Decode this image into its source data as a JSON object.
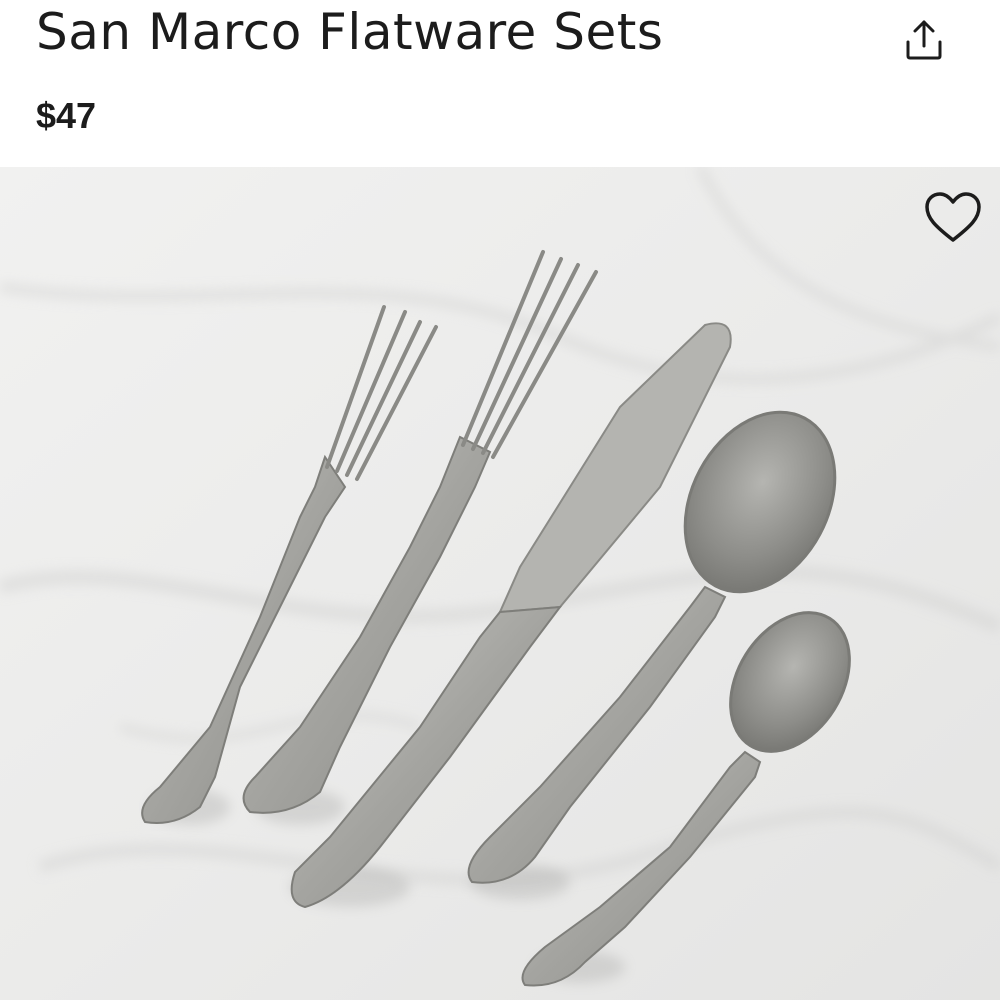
{
  "product": {
    "title": "San Marco Flatware Sets",
    "price": "$47"
  },
  "icons": {
    "share": "share-upload-icon",
    "favorite": "heart-outline-icon"
  },
  "image": {
    "subject": "flatware-place-setting",
    "items": [
      "salad-fork",
      "dinner-fork",
      "dinner-knife",
      "dinner-spoon",
      "teaspoon"
    ]
  },
  "colors": {
    "text": "#1c1c1c",
    "background": "#ffffff",
    "marble": "#eeeeee",
    "steel": "#a8a8a4"
  }
}
